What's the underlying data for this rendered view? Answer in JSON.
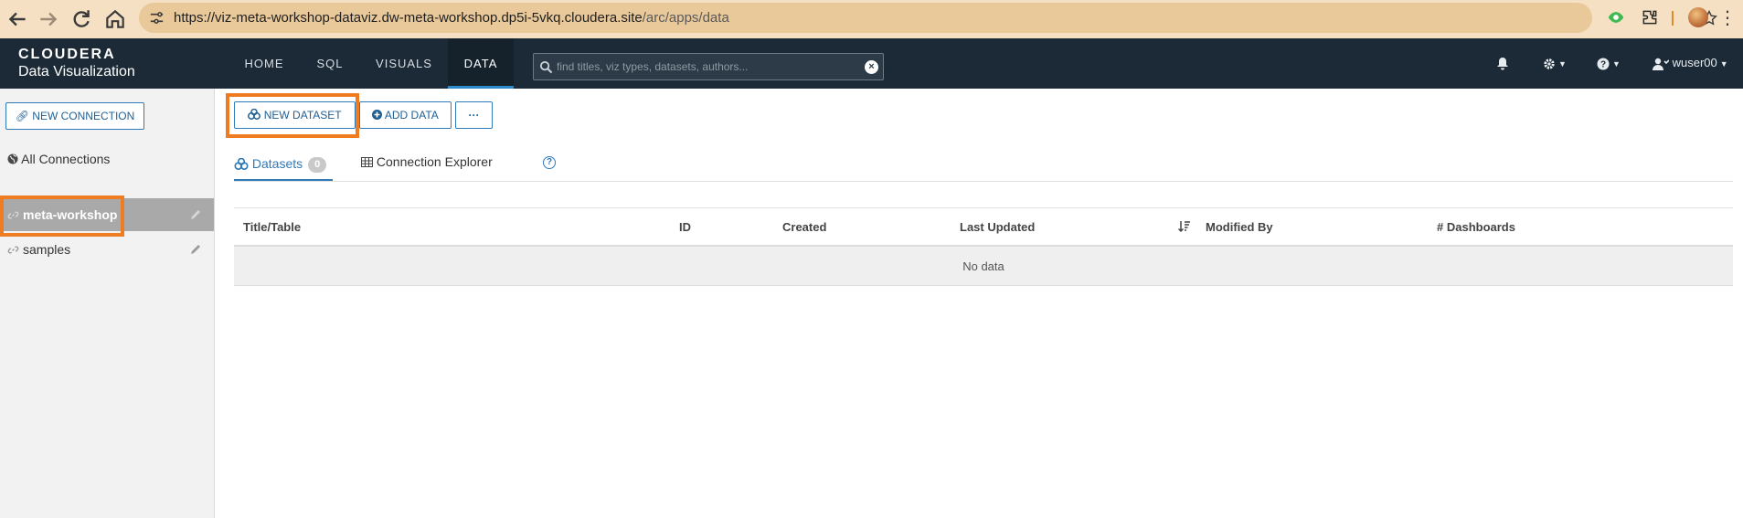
{
  "browser": {
    "url_host": "https://viz-meta-workshop-dataviz.dw-meta-workshop.dp5i-5vkq.cloudera.site",
    "url_path": "/arc/apps/data"
  },
  "app": {
    "brand_line1": "CLOUDERA",
    "brand_line2": "Data Visualization",
    "nav": [
      {
        "label": "HOME"
      },
      {
        "label": "SQL"
      },
      {
        "label": "VISUALS"
      },
      {
        "label": "DATA"
      }
    ],
    "search_placeholder": "find titles, viz types, datasets, authors...",
    "user": "wuser00"
  },
  "sidebar": {
    "new_connection_label": "NEW CONNECTION",
    "all_connections_label": "All Connections",
    "connections": [
      {
        "label": "meta-workshop"
      },
      {
        "label": "samples"
      }
    ]
  },
  "toolbar": {
    "new_dataset_label": "NEW DATASET",
    "add_data_label": "ADD DATA",
    "more_label": "···"
  },
  "tabs": {
    "datasets_label": "Datasets",
    "datasets_count": "0",
    "explorer_label": "Connection Explorer",
    "help_label": "?"
  },
  "table": {
    "columns": [
      "Title/Table",
      "ID",
      "Created",
      "Last Updated",
      "Modified By",
      "# Dashboards"
    ],
    "empty_text": "No data"
  },
  "colors": {
    "accent": "#2f7ab8",
    "header_bg": "#1b2a36",
    "highlight": "#f07c22",
    "browser_bar": "#f6e0c3"
  }
}
